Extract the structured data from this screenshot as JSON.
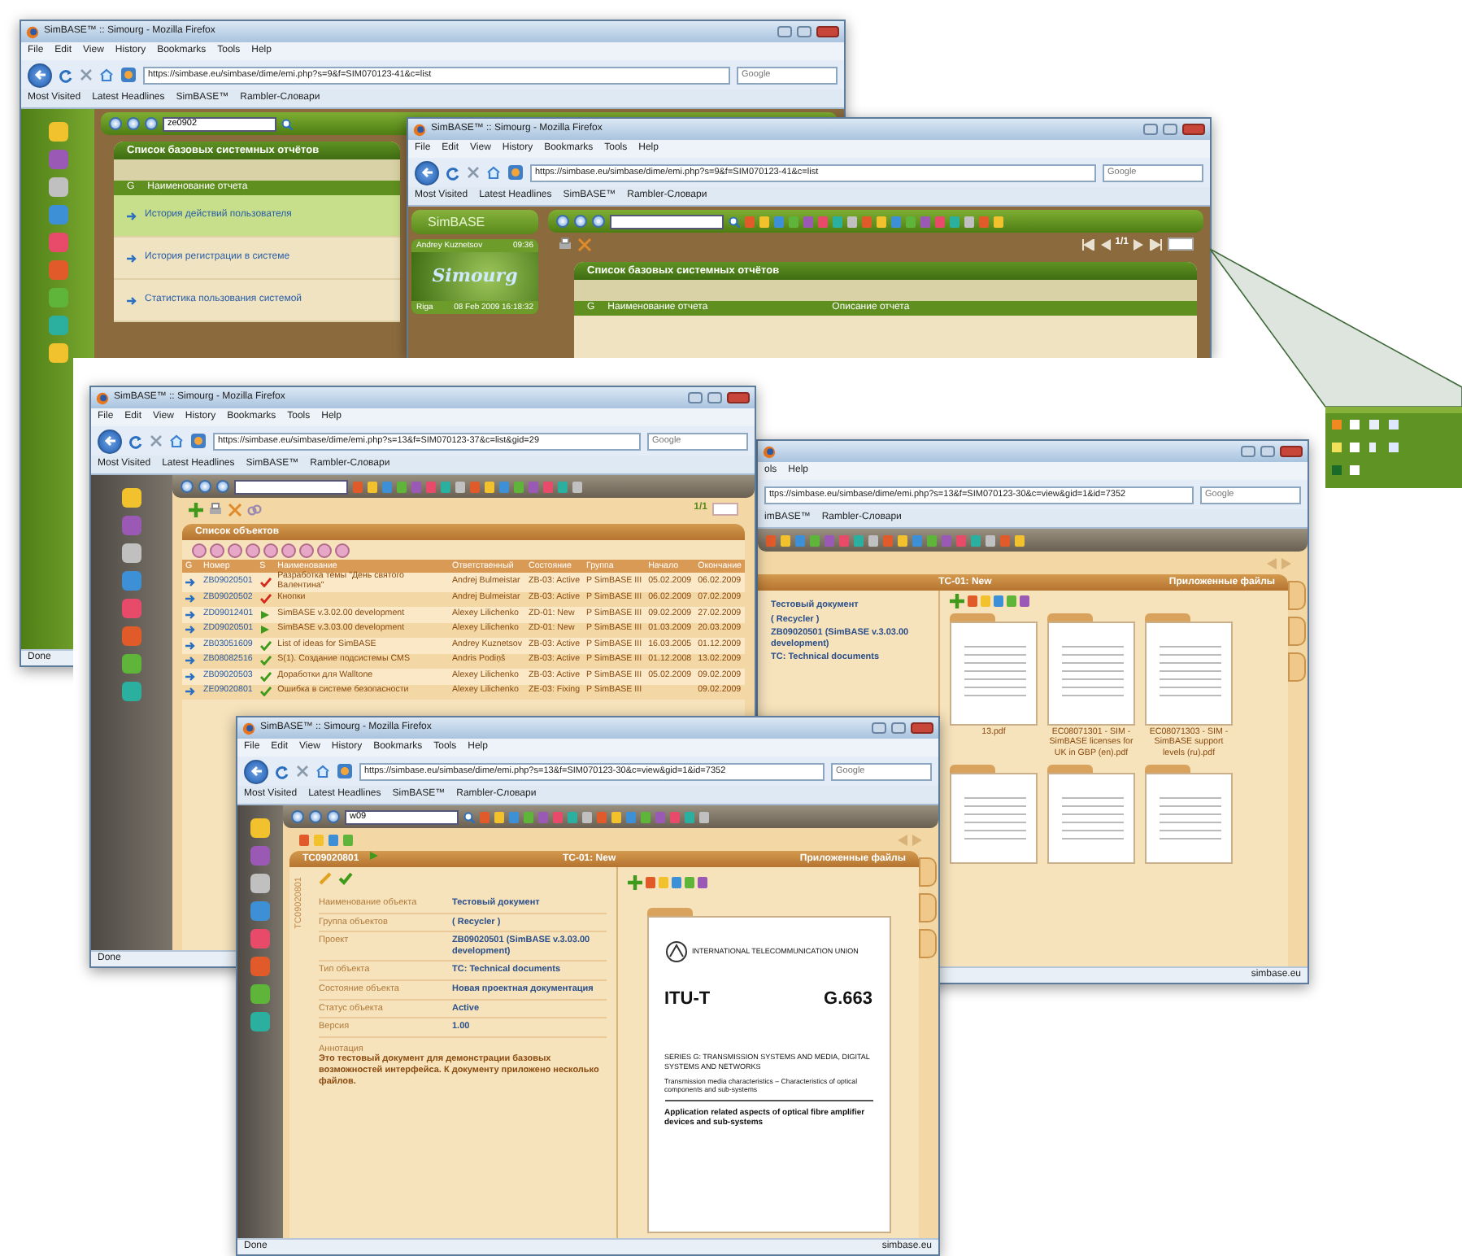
{
  "windows": [
    {
      "kind": "reports",
      "title": "SimBASE™ :: Simourg - Mozilla Firefox",
      "menu": [
        "File",
        "Edit",
        "View",
        "History",
        "Bookmarks",
        "Tools",
        "Help"
      ],
      "url": "https://simbase.eu/simbase/dime/emi.php?s=9&f=SIM070123-41&c=list",
      "search_placeholder": "Google",
      "bookmarks": [
        "Most Visited",
        "Latest Headlines",
        "SimBASE™",
        "Rambler-Словари"
      ],
      "quick_search": "ze0902",
      "heading": "Список базовых системных отчётов",
      "column_marker": "G",
      "column": "Наименование отчета",
      "reports": [
        {
          "label": "История действий пользователя",
          "selected": true
        },
        {
          "label": "История регистрации в системе",
          "selected": false
        },
        {
          "label": "Статистика пользования системой",
          "selected": false
        }
      ],
      "status": "Done"
    },
    {
      "kind": "reports_top",
      "title": "SimBASE™ :: Simourg - Mozilla Firefox",
      "menu": [
        "File",
        "Edit",
        "View",
        "History",
        "Bookmarks",
        "Tools",
        "Help"
      ],
      "url": "https://simbase.eu/simbase/dime/emi.php?s=9&f=SIM070123-41&c=list",
      "search_placeholder": "Google",
      "bookmarks": [
        "Most Visited",
        "Latest Headlines",
        "SimBASE™",
        "Rambler-Словари"
      ],
      "logo": "SimBASE",
      "user": "Andrey Kuznetsov",
      "clock": "09:36",
      "brand": "Simourg",
      "city": "Riga",
      "datetime": "08 Feb 2009 16:18:32",
      "pager": "1/1",
      "heading": "Список базовых системных отчётов",
      "column_marker": "G",
      "columns": [
        "Наименование отчета",
        "Описание отчета"
      ]
    },
    {
      "kind": "list",
      "title": "SimBASE™ :: Simourg - Mozilla Firefox",
      "menu": [
        "File",
        "Edit",
        "View",
        "History",
        "Bookmarks",
        "Tools",
        "Help"
      ],
      "url": "https://simbase.eu/simbase/dime/emi.php?s=13&f=SIM070123-37&c=list&gid=29",
      "search_placeholder": "Google",
      "bookmarks": [
        "Most Visited",
        "Latest Headlines",
        "SimBASE™",
        "Rambler-Словари"
      ],
      "pager": "1/1",
      "heading": "Список объектов",
      "columns": [
        "G",
        "Номер",
        "S",
        "Наименование",
        "Ответственный",
        "Состояние",
        "Группа",
        "Начало",
        "Окончание"
      ],
      "rows": [
        {
          "number": "ZB09020501",
          "kind": "check",
          "color": "#d42a1e",
          "name": "Разработка темы \"День святого Валентина\"",
          "owner": "Andrej Bulmeistar",
          "state": "ZB-03: Active",
          "group": "P SimBASE III",
          "start": "05.02.2009",
          "end": "06.02.2009"
        },
        {
          "number": "ZB09020502",
          "kind": "check",
          "color": "#d42a1e",
          "name": "Кнопки",
          "owner": "Andrej Bulmeistar",
          "state": "ZB-03: Active",
          "group": "P SimBASE III",
          "start": "06.02.2009",
          "end": "07.02.2009"
        },
        {
          "number": "ZD09012401",
          "kind": "play",
          "color": "#3f9a1c",
          "name": "SimBASE v.3.02.00 development",
          "owner": "Alexey Lilichenko",
          "state": "ZD-01: New",
          "group": "P SimBASE III",
          "start": "09.02.2009",
          "end": "27.02.2009"
        },
        {
          "number": "ZD09020501",
          "kind": "play",
          "color": "#3f9a1c",
          "name": "SimBASE v.3.03.00 development",
          "owner": "Alexey Lilichenko",
          "state": "ZD-01: New",
          "group": "P SimBASE III",
          "start": "01.03.2009",
          "end": "20.03.2009"
        },
        {
          "number": "ZB03051609",
          "kind": "check",
          "color": "#3f9a1c",
          "name": "List of ideas for SimBASE",
          "owner": "Andrey Kuznetsov",
          "state": "ZB-03: Active",
          "group": "P SimBASE III",
          "start": "16.03.2005",
          "end": "01.12.2009"
        },
        {
          "number": "ZB08082516",
          "kind": "check",
          "color": "#3f9a1c",
          "name": "S(1). Создание подсистемы CMS",
          "owner": "Andris Podiņš",
          "state": "ZB-03: Active",
          "group": "P SimBASE III",
          "start": "01.12.2008",
          "end": "13.02.2009"
        },
        {
          "number": "ZB09020503",
          "kind": "check",
          "color": "#3f9a1c",
          "name": "Доработки для Walltone",
          "owner": "Alexey Lilichenko",
          "state": "ZB-03: Active",
          "group": "P SimBASE III",
          "start": "05.02.2009",
          "end": "09.02.2009"
        },
        {
          "number": "ZE09020801",
          "kind": "check",
          "color": "#3f9a1c",
          "name": "Ошибка в системе безопасности",
          "owner": "Alexey Lilichenko",
          "state": "ZE-03: Fixing",
          "group": "P SimBASE III",
          "end": "09.02.2009"
        }
      ],
      "status": "Done"
    },
    {
      "kind": "files",
      "menu": [
        "ols",
        "Help"
      ],
      "url": "ttps://simbase.eu/simbase/dime/emi.php?s=13&f=SIM070123-30&c=view&gid=1&id=7352",
      "search_placeholder": "Google",
      "bookmarks": [
        "imBASE™",
        "Rambler-Словари"
      ],
      "state_title": "TC-01: New",
      "files_title": "Приложенные файлы",
      "values": [
        "Тестовый документ",
        "( Recycler )",
        "ZB09020501 (SimBASE v.3.03.00 development)",
        "TC: Technical documents"
      ],
      "files": [
        {
          "kind": "document",
          "name": "13.pdf"
        },
        {
          "kind": "document",
          "name": "EC08071301 - SIM - SimBASE licenses for UK in GBP (en).pdf"
        },
        {
          "kind": "document",
          "name": "EC08071303 - SIM - SimBASE support levels (ru).pdf"
        },
        {
          "kind": "document"
        },
        {
          "kind": "document"
        },
        {
          "kind": "document"
        }
      ],
      "status_right": "simbase.eu"
    },
    {
      "kind": "detail",
      "title": "SimBASE™ :: Simourg - Mozilla Firefox",
      "menu": [
        "File",
        "Edit",
        "View",
        "History",
        "Bookmarks",
        "Tools",
        "Help"
      ],
      "url": "https://simbase.eu/simbase/dime/emi.php?s=13&f=SIM070123-30&c=view&gid=1&id=7352",
      "search_placeholder": "Google",
      "bookmarks": [
        "Most Visited",
        "Latest Headlines",
        "SimBASE™",
        "Rambler-Словари"
      ],
      "quick_search": "w09",
      "object": "TC09020801",
      "state_title": "TC-01: New",
      "files_title": "Приложенные файлы",
      "side_tab": "TC09020801",
      "fields": [
        {
          "label": "Наименование объекта",
          "value": "Тестовый документ"
        },
        {
          "label": "Группа объектов",
          "value": "( Recycler )"
        },
        {
          "label": "Проект",
          "value": "ZB09020501 (SimBASE v.3.03.00 development)"
        },
        {
          "label": "Тип объекта",
          "value": "TC: Technical documents"
        },
        {
          "label": "Состояние объекта",
          "value": "Новая проектная документация"
        },
        {
          "label": "Статус объекта",
          "value": "Active"
        },
        {
          "label": "Версия",
          "value": "1.00"
        }
      ],
      "annotation_label": "Аннотация",
      "annotation": "Это тестовый документ для демонстрации базовых возможностей интерфейса. К документу приложено несколько файлов.",
      "preview": {
        "org": "INTERNATIONAL TELECOMMUNICATION UNION",
        "series": "ITU-T",
        "number": "G.663",
        "series_title": "SERIES G: TRANSMISSION SYSTEMS AND MEDIA, DIGITAL SYSTEMS AND NETWORKS",
        "subtitle": "Transmission media characteristics – Characteristics of optical components and sub-systems",
        "doc_title": "Application related aspects of optical fibre amplifier devices and sub-systems"
      },
      "status": "Done",
      "status_right": "simbase.eu"
    }
  ]
}
